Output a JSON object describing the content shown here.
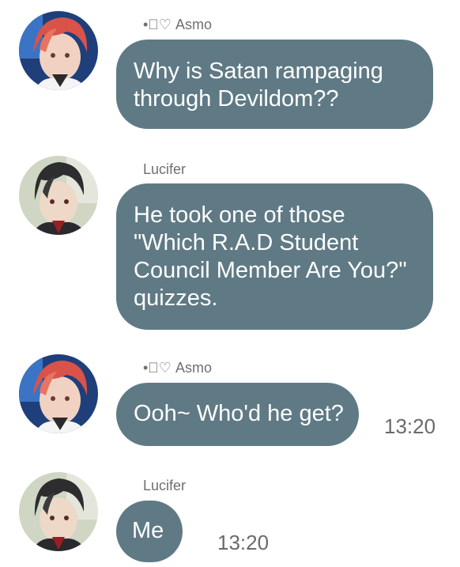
{
  "messages": [
    {
      "sender": "•ু♡ Asmo",
      "lines": [
        "Why is Satan rampaging",
        "through Devildom??"
      ],
      "time": "",
      "avatar_icon": "asmo-avatar-icon"
    },
    {
      "sender": "Lucifer",
      "lines": [
        "He took one of those",
        "\"Which R.A.D Student",
        "Council Member Are You?\"",
        "quizzes."
      ],
      "time": "",
      "avatar_icon": "lucifer-avatar-icon"
    },
    {
      "sender": "•ু♡ Asmo",
      "lines": [
        "Ooh~ Who'd he get?"
      ],
      "time": "13:20",
      "avatar_icon": "asmo-avatar-icon"
    },
    {
      "sender": "Lucifer",
      "lines": [
        "Me"
      ],
      "time": "13:20",
      "avatar_icon": "lucifer-avatar-icon"
    }
  ],
  "colors": {
    "bubble": "#5f7a85",
    "bubble_text": "#ffffff",
    "sender_text": "#6f6f6f",
    "time_text": "#6a6a6a"
  }
}
